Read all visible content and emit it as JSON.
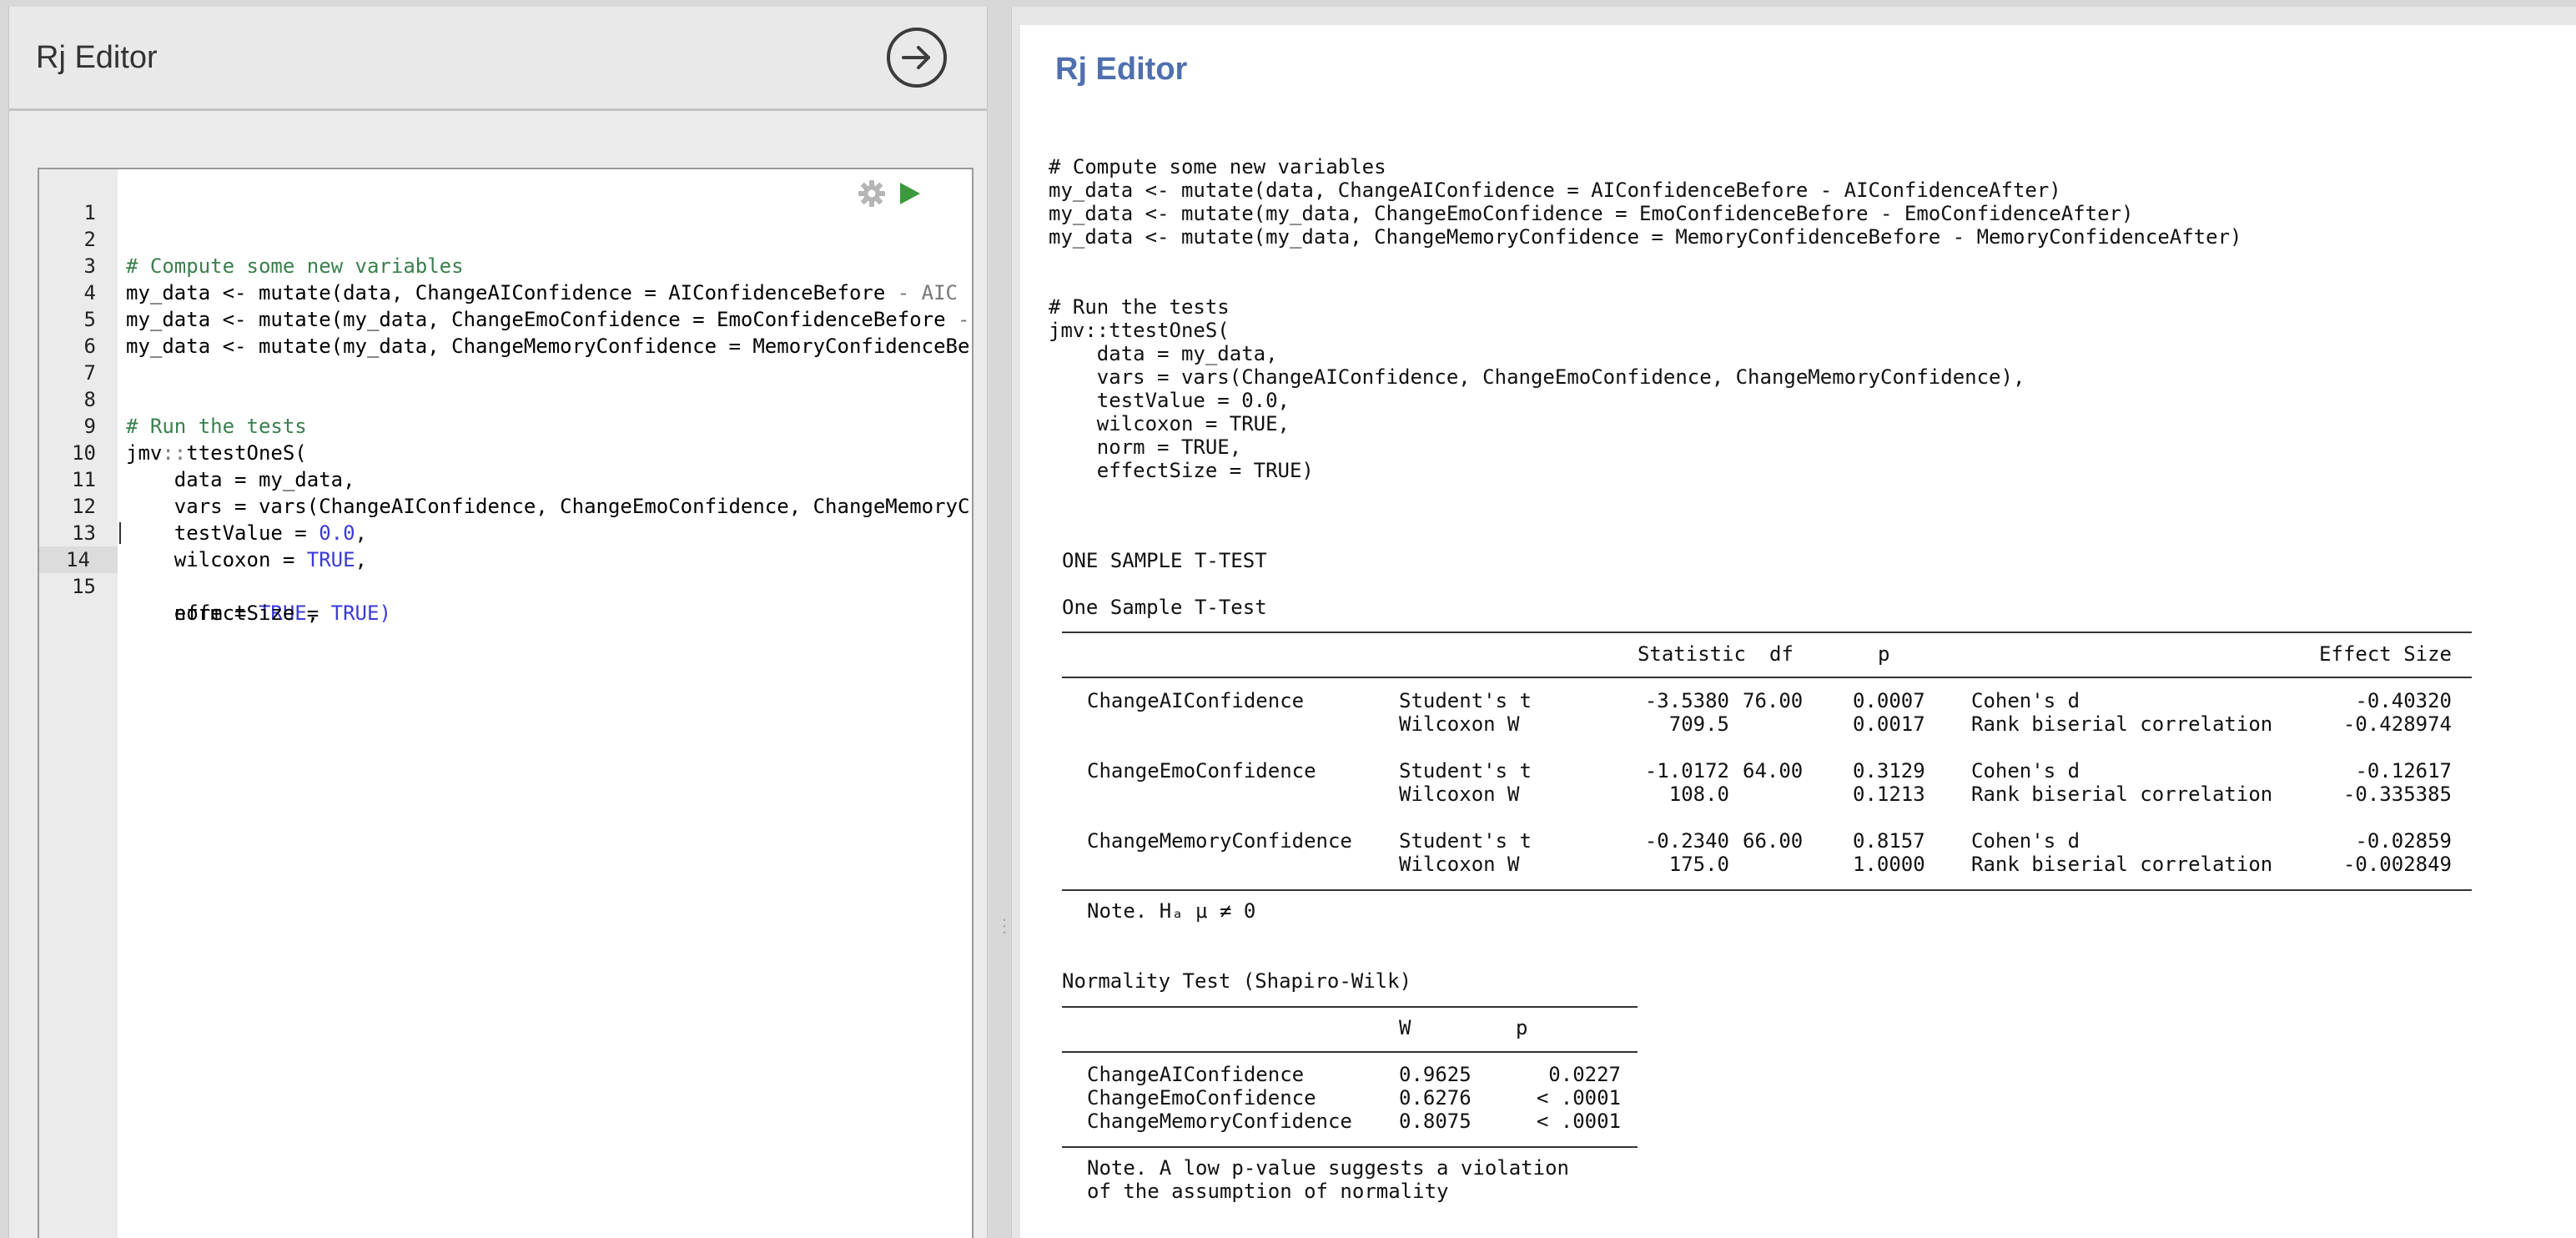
{
  "left_panel": {
    "title": "Rj Editor",
    "code_lines": [
      {
        "num": "1",
        "html_parts": []
      },
      {
        "num": "2"
      },
      {
        "num": "3"
      },
      {
        "num": "4"
      },
      {
        "num": "5"
      },
      {
        "num": "6"
      },
      {
        "num": "7"
      },
      {
        "num": "8"
      },
      {
        "num": "9"
      },
      {
        "num": "10"
      },
      {
        "num": "11"
      },
      {
        "num": "12"
      },
      {
        "num": "13"
      },
      {
        "num": "14"
      },
      {
        "num": "15"
      }
    ],
    "code": {
      "l2": "# Compute some new variables",
      "l3a": "my_data <- mutate(data, ChangeAIConfidence = AIConfidenceBefore ",
      "l3b": "- AIC",
      "l4a": "my_data <- mutate(my_data, ChangeEmoConfidence = EmoConfidenceBefore ",
      "l4b": "-",
      "l5": "my_data <- mutate(my_data, ChangeMemoryConfidence = MemoryConfidenceBe",
      "l8": "# Run the tests",
      "l9a": "jmv",
      "l9b": "::",
      "l9c": "ttestOneS(",
      "l10": "    data = my_data,",
      "l11": "    vars = vars(ChangeAIConfidence, ChangeEmoConfidence, ChangeMemoryC",
      "l12a": "    testValue = ",
      "l12b": "0.0",
      "l12c": ",",
      "l13a": "    wilcoxon = ",
      "l13b": "TRUE",
      "l13c": ",",
      "l14a": "    norm = ",
      "l14b": "TRUE",
      "l14c": ",",
      "l15a": "    effectSize = ",
      "l15b": "TRUE)"
    }
  },
  "right_panel": {
    "title": "Rj Editor",
    "echo": [
      "# Compute some new variables",
      "my_data <- mutate(data, ChangeAIConfidence = AIConfidenceBefore - AIConfidenceAfter)",
      "my_data <- mutate(my_data, ChangeEmoConfidence = EmoConfidenceBefore - EmoConfidenceAfter)",
      "my_data <- mutate(my_data, ChangeMemoryConfidence = MemoryConfidenceBefore - MemoryConfidenceAfter)",
      "# Run the tests",
      "jmv::ttestOneS(",
      "    data = my_data,",
      "    vars = vars(ChangeAIConfidence, ChangeEmoConfidence, ChangeMemoryConfidence),",
      "    testValue = 0.0,",
      "    wilcoxon = TRUE,",
      "    norm = TRUE,",
      "    effectSize = TRUE)"
    ],
    "ttest": {
      "heading": "ONE SAMPLE T-TEST",
      "table_title": "One Sample T-Test",
      "headers": {
        "statistic": "Statistic",
        "df": "df",
        "p": "p",
        "effect": "Effect Size"
      },
      "rows": [
        {
          "var": "ChangeAIConfidence",
          "t_label": "Student's t",
          "t_stat": "-3.5380",
          "t_df": "76.00",
          "t_p": "0.0007",
          "t_es_label": "Cohen's d",
          "t_es": "-0.40320",
          "w_label": "Wilcoxon W",
          "w_stat": "709.5",
          "w_p": "0.0017",
          "w_es_label": "Rank biserial correlation",
          "w_es": "-0.428974"
        },
        {
          "var": "ChangeEmoConfidence",
          "t_label": "Student's t",
          "t_stat": "-1.0172",
          "t_df": "64.00",
          "t_p": "0.3129",
          "t_es_label": "Cohen's d",
          "t_es": "-0.12617",
          "w_label": "Wilcoxon W",
          "w_stat": "108.0",
          "w_p": "0.1213",
          "w_es_label": "Rank biserial correlation",
          "w_es": "-0.335385"
        },
        {
          "var": "ChangeMemoryConfidence",
          "t_label": "Student's t",
          "t_stat": "-0.2340",
          "t_df": "66.00",
          "t_p": "0.8157",
          "t_es_label": "Cohen's d",
          "t_es": "-0.02859",
          "w_label": "Wilcoxon W",
          "w_stat": "175.0",
          "w_p": "1.0000",
          "w_es_label": "Rank biserial correlation",
          "w_es": "-0.002849"
        }
      ],
      "note": "Note. Hₐ μ ≠ 0"
    },
    "normality": {
      "title": "Normality Test (Shapiro-Wilk)",
      "headers": {
        "w": "W",
        "p": "p"
      },
      "rows": [
        {
          "var": "ChangeAIConfidence",
          "w": "0.9625",
          "p": "0.0227"
        },
        {
          "var": "ChangeEmoConfidence",
          "w": "0.6276",
          "p": "< .0001"
        },
        {
          "var": "ChangeMemoryConfidence",
          "w": "0.8075",
          "p": "< .0001"
        }
      ],
      "note1": "Note. A low p-value suggests a violation",
      "note2": "of the assumption of normality"
    }
  },
  "icons": {
    "run_circle": "arrow-right-circle-icon",
    "gear": "gear-icon",
    "run": "play-icon",
    "splitter": "drag-handle-icon"
  },
  "colors": {
    "title_blue": "#4f6fae",
    "comment_green": "#3a7f4e",
    "keyword_blue": "#3a3ad8",
    "run_green": "#3c9a3c"
  }
}
